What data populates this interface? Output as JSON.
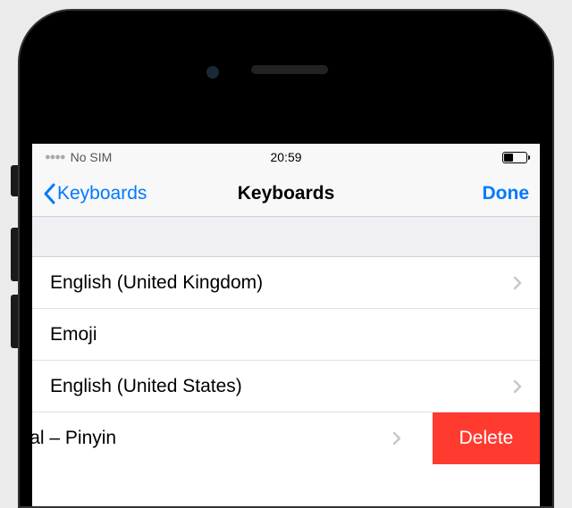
{
  "status_bar": {
    "carrier": "No SIM",
    "time": "20:59"
  },
  "nav": {
    "back_label": "Keyboards",
    "title": "Keyboards",
    "done_label": "Done"
  },
  "keyboards": [
    {
      "label": "English (United Kingdom)",
      "has_chevron": true
    },
    {
      "label": "Emoji",
      "has_chevron": false
    },
    {
      "label": "English (United States)",
      "has_chevron": true
    }
  ],
  "swiped_row": {
    "label": ", Traditional – Pinyin",
    "delete_label": "Delete"
  }
}
